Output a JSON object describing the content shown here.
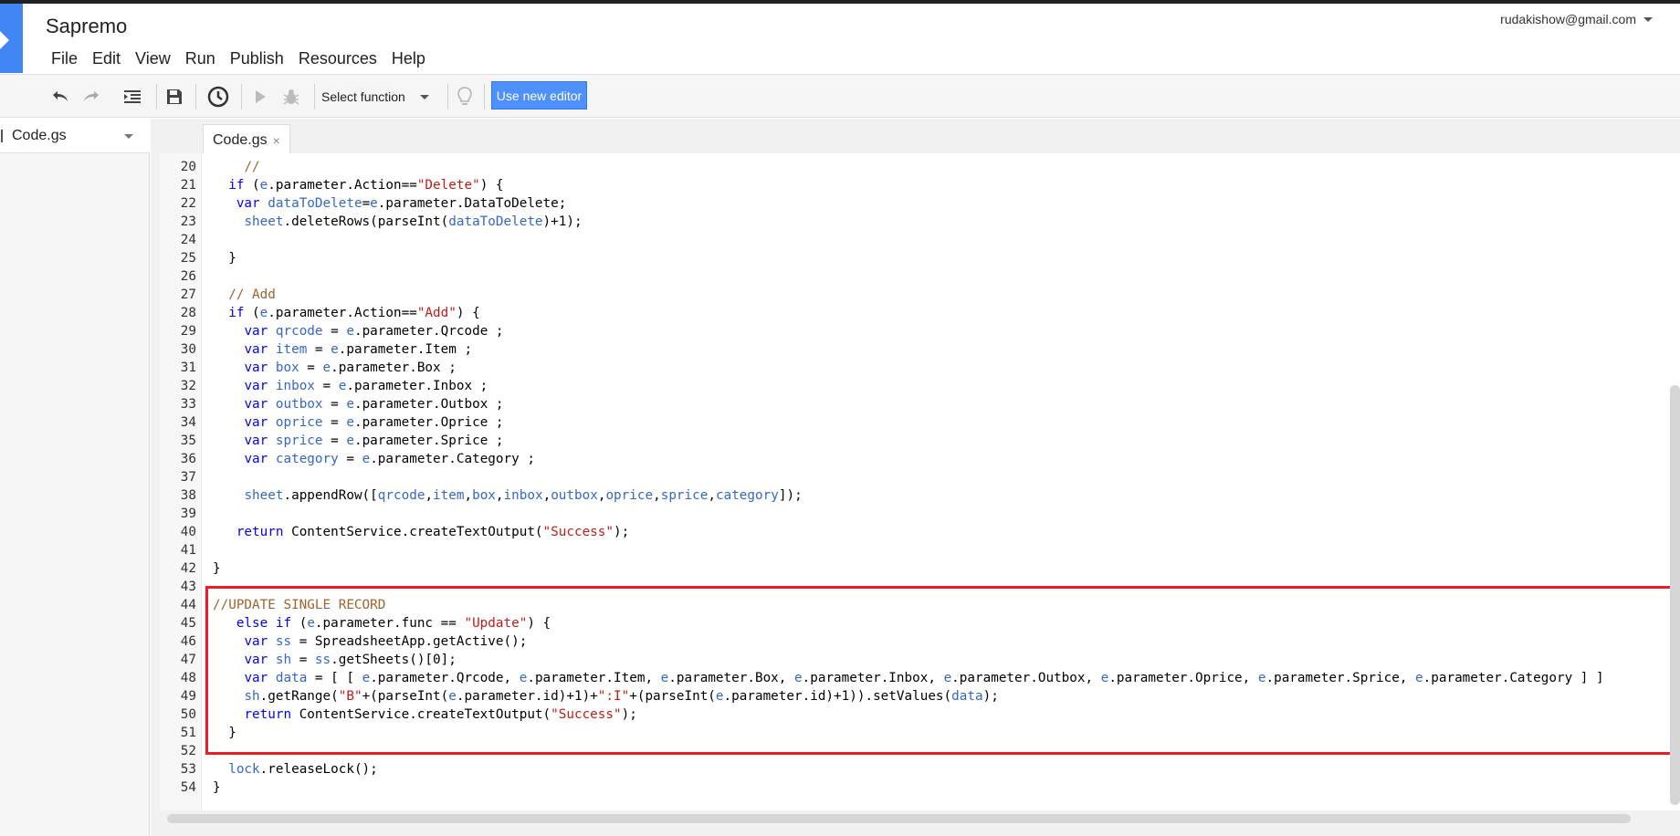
{
  "app": {
    "title": "Sapremo",
    "account": "rudakishow@gmail.com"
  },
  "menu": [
    "File",
    "Edit",
    "View",
    "Run",
    "Publish",
    "Resources",
    "Help"
  ],
  "toolbar": {
    "select_function_label": "Select function",
    "new_editor_label": "Use new editor"
  },
  "sidebar": {
    "file": "Code.gs"
  },
  "tab": {
    "label": "Code.gs",
    "close": "×"
  },
  "code": {
    "lines": [
      {
        "n": "20",
        "parts": [
          {
            "t": "    "
          },
          {
            "t": "//",
            "c": "kc"
          }
        ]
      },
      {
        "n": "21",
        "parts": [
          {
            "t": "  "
          },
          {
            "t": "if",
            "c": "kw"
          },
          {
            "t": " ("
          },
          {
            "t": "e",
            "c": "kv"
          },
          {
            "t": ".parameter.Action=="
          },
          {
            "t": "\"Delete\"",
            "c": "ks"
          },
          {
            "t": ") {"
          }
        ]
      },
      {
        "n": "22",
        "parts": [
          {
            "t": "   "
          },
          {
            "t": "var",
            "c": "kw"
          },
          {
            "t": " "
          },
          {
            "t": "dataToDelete",
            "c": "kv"
          },
          {
            "t": "="
          },
          {
            "t": "e",
            "c": "kv"
          },
          {
            "t": ".parameter.DataToDelete;"
          }
        ]
      },
      {
        "n": "23",
        "parts": [
          {
            "t": "    "
          },
          {
            "t": "sheet",
            "c": "kv"
          },
          {
            "t": ".deleteRows(parseInt("
          },
          {
            "t": "dataToDelete",
            "c": "kv"
          },
          {
            "t": ")+1);"
          }
        ]
      },
      {
        "n": "24",
        "parts": [
          {
            "t": ""
          }
        ]
      },
      {
        "n": "25",
        "parts": [
          {
            "t": "  }"
          }
        ]
      },
      {
        "n": "26",
        "parts": [
          {
            "t": ""
          }
        ]
      },
      {
        "n": "27",
        "parts": [
          {
            "t": "  "
          },
          {
            "t": "// Add",
            "c": "kc"
          }
        ]
      },
      {
        "n": "28",
        "parts": [
          {
            "t": "  "
          },
          {
            "t": "if",
            "c": "kw"
          },
          {
            "t": " ("
          },
          {
            "t": "e",
            "c": "kv"
          },
          {
            "t": ".parameter.Action=="
          },
          {
            "t": "\"Add\"",
            "c": "ks"
          },
          {
            "t": ") {"
          }
        ]
      },
      {
        "n": "29",
        "parts": [
          {
            "t": "    "
          },
          {
            "t": "var",
            "c": "kw"
          },
          {
            "t": " "
          },
          {
            "t": "qrcode",
            "c": "kv"
          },
          {
            "t": " = "
          },
          {
            "t": "e",
            "c": "kv"
          },
          {
            "t": ".parameter.Qrcode ;"
          }
        ]
      },
      {
        "n": "30",
        "parts": [
          {
            "t": "    "
          },
          {
            "t": "var",
            "c": "kw"
          },
          {
            "t": " "
          },
          {
            "t": "item",
            "c": "kv"
          },
          {
            "t": " = "
          },
          {
            "t": "e",
            "c": "kv"
          },
          {
            "t": ".parameter.Item ;"
          }
        ]
      },
      {
        "n": "31",
        "parts": [
          {
            "t": "    "
          },
          {
            "t": "var",
            "c": "kw"
          },
          {
            "t": " "
          },
          {
            "t": "box",
            "c": "kv"
          },
          {
            "t": " = "
          },
          {
            "t": "e",
            "c": "kv"
          },
          {
            "t": ".parameter.Box ;"
          }
        ]
      },
      {
        "n": "32",
        "parts": [
          {
            "t": "    "
          },
          {
            "t": "var",
            "c": "kw"
          },
          {
            "t": " "
          },
          {
            "t": "inbox",
            "c": "kv"
          },
          {
            "t": " = "
          },
          {
            "t": "e",
            "c": "kv"
          },
          {
            "t": ".parameter.Inbox ;"
          }
        ]
      },
      {
        "n": "33",
        "parts": [
          {
            "t": "    "
          },
          {
            "t": "var",
            "c": "kw"
          },
          {
            "t": " "
          },
          {
            "t": "outbox",
            "c": "kv"
          },
          {
            "t": " = "
          },
          {
            "t": "e",
            "c": "kv"
          },
          {
            "t": ".parameter.Outbox ;"
          }
        ]
      },
      {
        "n": "34",
        "parts": [
          {
            "t": "    "
          },
          {
            "t": "var",
            "c": "kw"
          },
          {
            "t": " "
          },
          {
            "t": "oprice",
            "c": "kv"
          },
          {
            "t": " = "
          },
          {
            "t": "e",
            "c": "kv"
          },
          {
            "t": ".parameter.Oprice ;"
          }
        ]
      },
      {
        "n": "35",
        "parts": [
          {
            "t": "    "
          },
          {
            "t": "var",
            "c": "kw"
          },
          {
            "t": " "
          },
          {
            "t": "sprice",
            "c": "kv"
          },
          {
            "t": " = "
          },
          {
            "t": "e",
            "c": "kv"
          },
          {
            "t": ".parameter.Sprice ;"
          }
        ]
      },
      {
        "n": "36",
        "parts": [
          {
            "t": "    "
          },
          {
            "t": "var",
            "c": "kw"
          },
          {
            "t": " "
          },
          {
            "t": "category",
            "c": "kv"
          },
          {
            "t": " = "
          },
          {
            "t": "e",
            "c": "kv"
          },
          {
            "t": ".parameter.Category ;"
          }
        ]
      },
      {
        "n": "37",
        "parts": [
          {
            "t": ""
          }
        ]
      },
      {
        "n": "38",
        "parts": [
          {
            "t": "    "
          },
          {
            "t": "sheet",
            "c": "kv"
          },
          {
            "t": ".appendRow(["
          },
          {
            "t": "qrcode",
            "c": "kv"
          },
          {
            "t": ","
          },
          {
            "t": "item",
            "c": "kv"
          },
          {
            "t": ","
          },
          {
            "t": "box",
            "c": "kv"
          },
          {
            "t": ","
          },
          {
            "t": "inbox",
            "c": "kv"
          },
          {
            "t": ","
          },
          {
            "t": "outbox",
            "c": "kv"
          },
          {
            "t": ","
          },
          {
            "t": "oprice",
            "c": "kv"
          },
          {
            "t": ","
          },
          {
            "t": "sprice",
            "c": "kv"
          },
          {
            "t": ","
          },
          {
            "t": "category",
            "c": "kv"
          },
          {
            "t": "]);"
          }
        ]
      },
      {
        "n": "39",
        "parts": [
          {
            "t": ""
          }
        ]
      },
      {
        "n": "40",
        "parts": [
          {
            "t": "   "
          },
          {
            "t": "return",
            "c": "kw"
          },
          {
            "t": " ContentService.createTextOutput("
          },
          {
            "t": "\"Success\"",
            "c": "ks"
          },
          {
            "t": ");"
          }
        ]
      },
      {
        "n": "41",
        "parts": [
          {
            "t": ""
          }
        ]
      },
      {
        "n": "42",
        "parts": [
          {
            "t": "}"
          }
        ]
      },
      {
        "n": "43",
        "parts": [
          {
            "t": ""
          }
        ]
      },
      {
        "n": "44",
        "parts": [
          {
            "t": "//UPDATE SINGLE RECORD",
            "c": "kc"
          }
        ]
      },
      {
        "n": "45",
        "parts": [
          {
            "t": "   "
          },
          {
            "t": "else",
            "c": "kw"
          },
          {
            "t": " "
          },
          {
            "t": "if",
            "c": "kw"
          },
          {
            "t": " ("
          },
          {
            "t": "e",
            "c": "kv"
          },
          {
            "t": ".parameter.func == "
          },
          {
            "t": "\"Update\"",
            "c": "ks"
          },
          {
            "t": ") {"
          }
        ]
      },
      {
        "n": "46",
        "parts": [
          {
            "t": "    "
          },
          {
            "t": "var",
            "c": "kw"
          },
          {
            "t": " "
          },
          {
            "t": "ss",
            "c": "kv"
          },
          {
            "t": " = SpreadsheetApp.getActive();"
          }
        ]
      },
      {
        "n": "47",
        "parts": [
          {
            "t": "    "
          },
          {
            "t": "var",
            "c": "kw"
          },
          {
            "t": " "
          },
          {
            "t": "sh",
            "c": "kv"
          },
          {
            "t": " = "
          },
          {
            "t": "ss",
            "c": "kv"
          },
          {
            "t": ".getSheets()[0];"
          }
        ]
      },
      {
        "n": "48",
        "parts": [
          {
            "t": "    "
          },
          {
            "t": "var",
            "c": "kw"
          },
          {
            "t": " "
          },
          {
            "t": "data",
            "c": "kv"
          },
          {
            "t": " = [ [ "
          },
          {
            "t": "e",
            "c": "kv"
          },
          {
            "t": ".parameter.Qrcode, "
          },
          {
            "t": "e",
            "c": "kv"
          },
          {
            "t": ".parameter.Item, "
          },
          {
            "t": "e",
            "c": "kv"
          },
          {
            "t": ".parameter.Box, "
          },
          {
            "t": "e",
            "c": "kv"
          },
          {
            "t": ".parameter.Inbox, "
          },
          {
            "t": "e",
            "c": "kv"
          },
          {
            "t": ".parameter.Outbox, "
          },
          {
            "t": "e",
            "c": "kv"
          },
          {
            "t": ".parameter.Oprice, "
          },
          {
            "t": "e",
            "c": "kv"
          },
          {
            "t": ".parameter.Sprice, "
          },
          {
            "t": "e",
            "c": "kv"
          },
          {
            "t": ".parameter.Category ] ]"
          }
        ]
      },
      {
        "n": "49",
        "parts": [
          {
            "t": "    "
          },
          {
            "t": "sh",
            "c": "kv"
          },
          {
            "t": ".getRange("
          },
          {
            "t": "\"B\"",
            "c": "ks"
          },
          {
            "t": "+(parseInt("
          },
          {
            "t": "e",
            "c": "kv"
          },
          {
            "t": ".parameter.id)+1)+"
          },
          {
            "t": "\":I\"",
            "c": "ks"
          },
          {
            "t": "+(parseInt("
          },
          {
            "t": "e",
            "c": "kv"
          },
          {
            "t": ".parameter.id)+1)).setValues("
          },
          {
            "t": "data",
            "c": "kv"
          },
          {
            "t": ");"
          }
        ]
      },
      {
        "n": "50",
        "parts": [
          {
            "t": "    "
          },
          {
            "t": "return",
            "c": "kw"
          },
          {
            "t": " ContentService.createTextOutput("
          },
          {
            "t": "\"Success\"",
            "c": "ks"
          },
          {
            "t": ");"
          }
        ]
      },
      {
        "n": "51",
        "parts": [
          {
            "t": "  }"
          }
        ]
      },
      {
        "n": "52",
        "parts": [
          {
            "t": ""
          }
        ]
      },
      {
        "n": "53",
        "parts": [
          {
            "t": "  "
          },
          {
            "t": "lock",
            "c": "kv"
          },
          {
            "t": ".releaseLock();"
          }
        ]
      },
      {
        "n": "54",
        "parts": [
          {
            "t": "}"
          }
        ]
      }
    ]
  }
}
